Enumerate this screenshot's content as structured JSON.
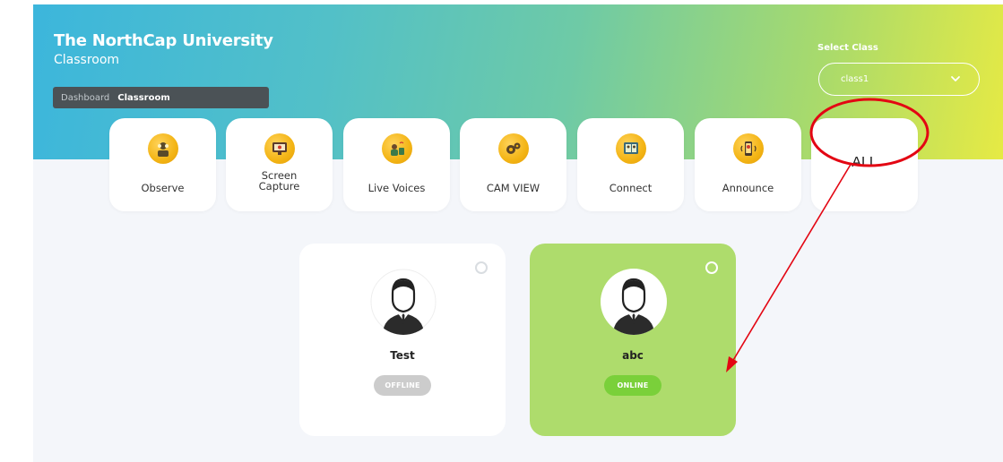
{
  "header": {
    "title": "The NorthCap University",
    "subtitle": "Classroom"
  },
  "breadcrumb": {
    "items": [
      "Dashboard",
      "Classroom"
    ]
  },
  "class_select": {
    "label": "Select Class",
    "value": "class1"
  },
  "tools": [
    {
      "label": "Observe",
      "icon": "observe-icon"
    },
    {
      "label": "Screen\nCapture",
      "icon": "screen-capture-icon"
    },
    {
      "label": "Live Voices",
      "icon": "live-voices-icon"
    },
    {
      "label": "CAM VIEW",
      "icon": "cam-view-icon"
    },
    {
      "label": "Connect",
      "icon": "connect-icon"
    },
    {
      "label": "Announce",
      "icon": "announce-icon"
    },
    {
      "label": "ALL",
      "icon": ""
    }
  ],
  "students": [
    {
      "name": "Test",
      "status": "OFFLINE"
    },
    {
      "name": "abc",
      "status": "ONLINE"
    }
  ],
  "colors": {
    "accent_green": "#aedc6c",
    "online": "#7ad03a",
    "offline": "#cccccc",
    "annotation_red": "#e30613"
  }
}
